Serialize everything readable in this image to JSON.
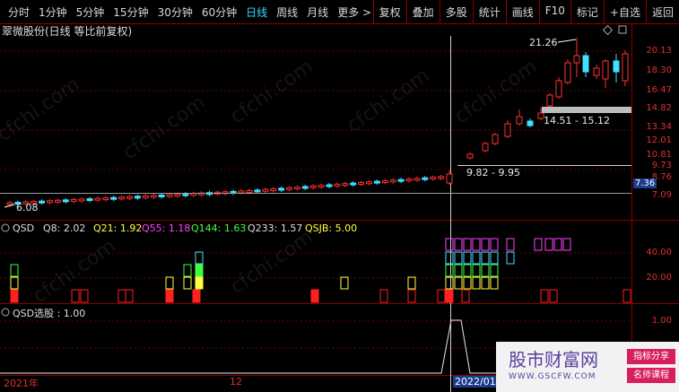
{
  "toolbar": {
    "left": [
      "分时",
      "1分钟",
      "5分钟",
      "15分钟",
      "30分钟",
      "60分钟",
      "日线",
      "周线",
      "月线",
      "更多 >"
    ],
    "active_index": 6,
    "right": [
      "复权",
      "叠加",
      "多股",
      "统计",
      "画线",
      "F10",
      "标记",
      "+自选",
      "返回"
    ]
  },
  "title": "翠微股份(日线 等比前复权)",
  "price_axis": [
    "20.13",
    "18.30",
    "16.47",
    "14.82",
    "13.34",
    "12.01",
    "10.81",
    "9.73",
    "8.76",
    "7.09"
  ],
  "current_price": "7.36",
  "annotations": {
    "high": "21.26",
    "gap1": "14.51 - 15.12",
    "gap2": "9.82 - 9.95",
    "low": "6.08"
  },
  "qsd": {
    "name": "QSD",
    "q8": "Q8: 2.02",
    "q21": "Q21: 1.92",
    "q55": "Q55: 1.18",
    "q144": "Q144: 1.63",
    "q233": "Q233: 1.57",
    "qsjb": "QSJB: 5.00",
    "axis": [
      "40.00",
      "20.00"
    ]
  },
  "select": {
    "label": "QSD选股 : 1.00",
    "axis": "1.00"
  },
  "time_axis": [
    "2021年",
    "12",
    "2022/01/0"
  ],
  "watermark": "cfchi.com",
  "logo": {
    "main": "股市财富网",
    "url": "WWW.GSCFW.COM",
    "tag1": "指标分享",
    "tag2": "名师课程"
  },
  "colors": {
    "up": "#ff3030",
    "down": "#40e0ff",
    "q21": "#ffff40",
    "q55": "#ff40ff",
    "q144": "#40ff40",
    "qsjb": "#ffff40"
  }
}
